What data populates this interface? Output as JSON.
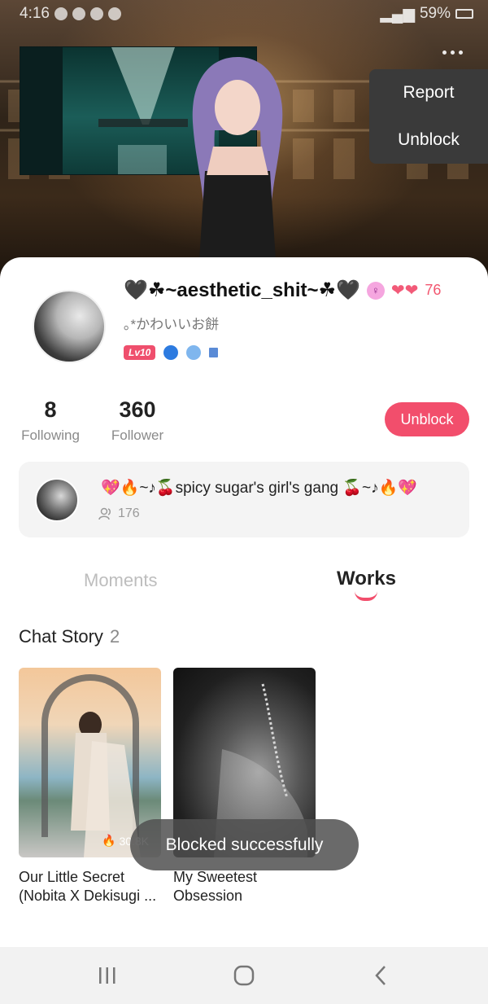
{
  "status_bar": {
    "time": "4:16",
    "battery": "59%"
  },
  "menu": {
    "report_label": "Report",
    "unblock_label": "Unblock"
  },
  "profile": {
    "username": "🖤☘~aesthetic_shit~☘🖤",
    "gender_symbol": "♀",
    "hearts_count": "76",
    "bio": "｡*かわいいお餅",
    "level_badge": "Lv10",
    "following_count": "8",
    "following_label": "Following",
    "follower_count": "360",
    "follower_label": "Follower",
    "unblock_button": "Unblock"
  },
  "group": {
    "name": "💖🔥~♪🍒spicy sugar's girl's gang 🍒~♪🔥💖",
    "members": "176"
  },
  "tabs": {
    "moments": "Moments",
    "works": "Works"
  },
  "section": {
    "title": "Chat Story",
    "count": "2"
  },
  "works": [
    {
      "title_line1": "Our Little Secret",
      "title_line2": "(Nobita X Dekisugi ...",
      "views": "30.8K"
    },
    {
      "title_line1": "My Sweetest",
      "title_line2": "Obsession"
    }
  ],
  "toast": {
    "message": "Blocked successfully"
  },
  "colors": {
    "accent": "#f24e6c",
    "menu_bg": "#3a3a3a",
    "toast_bg": "#505050"
  }
}
